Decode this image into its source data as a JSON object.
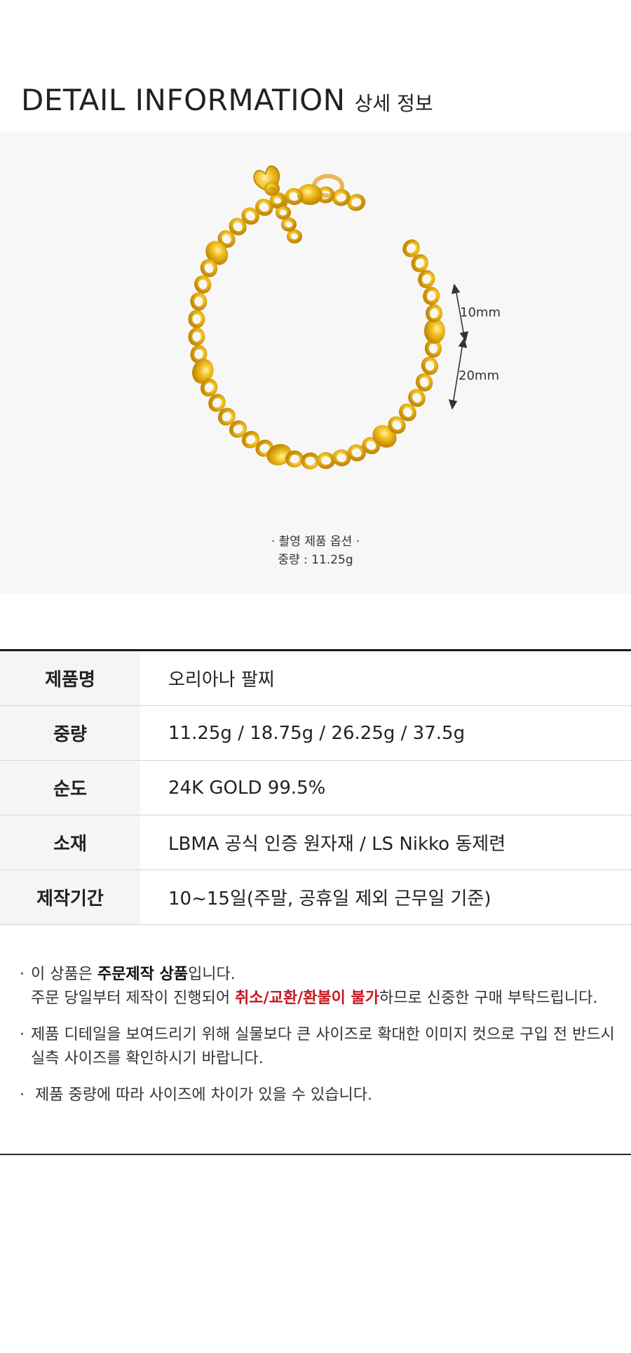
{
  "header": {
    "title_en": "DETAIL INFORMATION",
    "title_ko": "상세 정보"
  },
  "photo": {
    "dimension_labels": [
      "10mm",
      "20mm"
    ],
    "caption_line1": "· 촬영 제품 옵션 ·",
    "caption_line2": "중량 : 11.25g",
    "gold_color": "#e9b318"
  },
  "specs": [
    {
      "label": "제품명",
      "value": "오리아나 팔찌"
    },
    {
      "label": "중량",
      "value": "11.25g / 18.75g / 26.25g / 37.5g"
    },
    {
      "label": "순도",
      "value": "24K GOLD 99.5%"
    },
    {
      "label": "소재",
      "value": "LBMA 공식 인증 원자재 / LS Nikko 동제련"
    },
    {
      "label": "제작기간",
      "value": "10~15일(주말, 공휴일 제외 근무일 기준)"
    }
  ],
  "notes": {
    "n1_a": "이 상품은 ",
    "n1_b": "주문제작 상품",
    "n1_c": "입니다.",
    "n1_d": "주문 당일부터 제작이 진행되어 ",
    "n1_e": "취소/교환/환불이 불가",
    "n1_f": "하므로 신중한 구매 부탁드립니다.",
    "n2_a": "제품 디테일을 보여드리기 위해 실물보다 큰 사이즈로 확대한 이미지 컷으로 구입 전 반드시",
    "n2_b": "실측 사이즈를 확인하시기 바랍니다.",
    "n3": "제품 중량에 따라 사이즈에 차이가 있을 수 있습니다.",
    "bullet": "·"
  },
  "colors": {
    "accent_red": "#c8161e",
    "header_border": "#1a1a1a",
    "label_bg": "#f5f5f5"
  }
}
